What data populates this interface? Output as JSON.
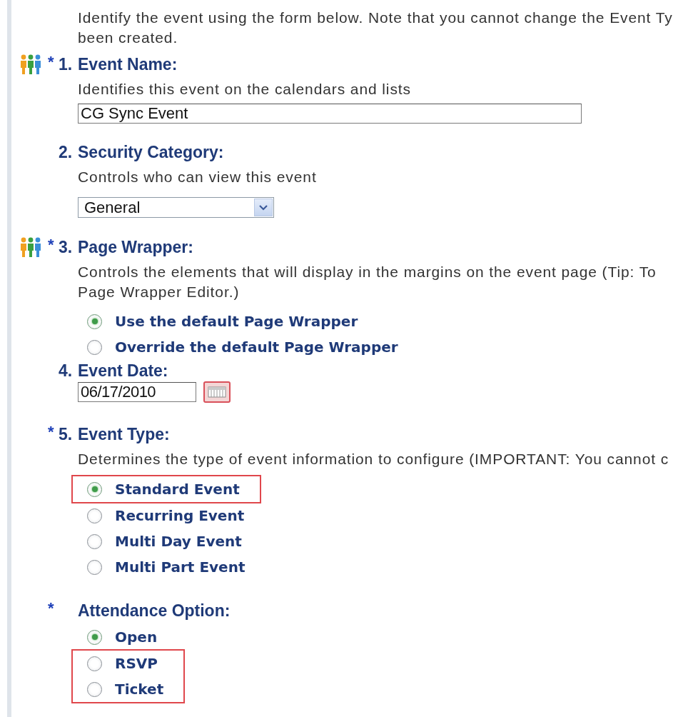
{
  "intro": {
    "lines": [
      "Identify the event using the form below. Note that you cannot change the Event Ty",
      "been created."
    ]
  },
  "fields": [
    {
      "kind": "text",
      "number": "1.",
      "label": "Event Name:",
      "asterisk": "*",
      "people_icon": true,
      "description": [
        "Identifies this event on the calendars and lists"
      ],
      "value": "CG Sync Event"
    },
    {
      "kind": "select",
      "number": "2.",
      "label": "Security Category:",
      "people_icon": false,
      "description": [
        "Controls who can view this event"
      ],
      "value": "General"
    },
    {
      "kind": "radios",
      "number": "3.",
      "label": "Page Wrapper:",
      "asterisk": "*",
      "people_icon": true,
      "description": [
        "Controls the elements that will display in the margins on the event page (Tip: To",
        "Page Wrapper Editor.)"
      ],
      "options": [
        {
          "label": "Use the default Page Wrapper",
          "selected": true,
          "highlighted": false
        },
        {
          "label": "Override the default Page Wrapper",
          "selected": false,
          "highlighted": false
        }
      ]
    },
    {
      "kind": "date",
      "number": "4.",
      "label": "Event Date:",
      "people_icon": false,
      "value": "06/17/2010"
    },
    {
      "kind": "radios",
      "number": "5.",
      "label": "Event Type:",
      "asterisk": "*",
      "people_icon": false,
      "description": [
        "Determines the type of event information to configure (IMPORTANT: You cannot c"
      ],
      "options": [
        {
          "label": "Standard Event",
          "selected": true,
          "highlighted": true
        },
        {
          "label": "Recurring Event",
          "selected": false,
          "highlighted": false
        },
        {
          "label": "Multi Day Event",
          "selected": false,
          "highlighted": false
        },
        {
          "label": "Multi Part Event",
          "selected": false,
          "highlighted": false
        }
      ]
    },
    {
      "kind": "radios",
      "label": "Attendance Option:",
      "asterisk": "*",
      "people_icon": false,
      "options": [
        {
          "label": "Open",
          "selected": true,
          "highlighted": false
        },
        {
          "label": "RSVP",
          "selected": false,
          "highlighted": true
        },
        {
          "label": "Ticket",
          "selected": false,
          "highlighted": true
        }
      ]
    }
  ]
}
